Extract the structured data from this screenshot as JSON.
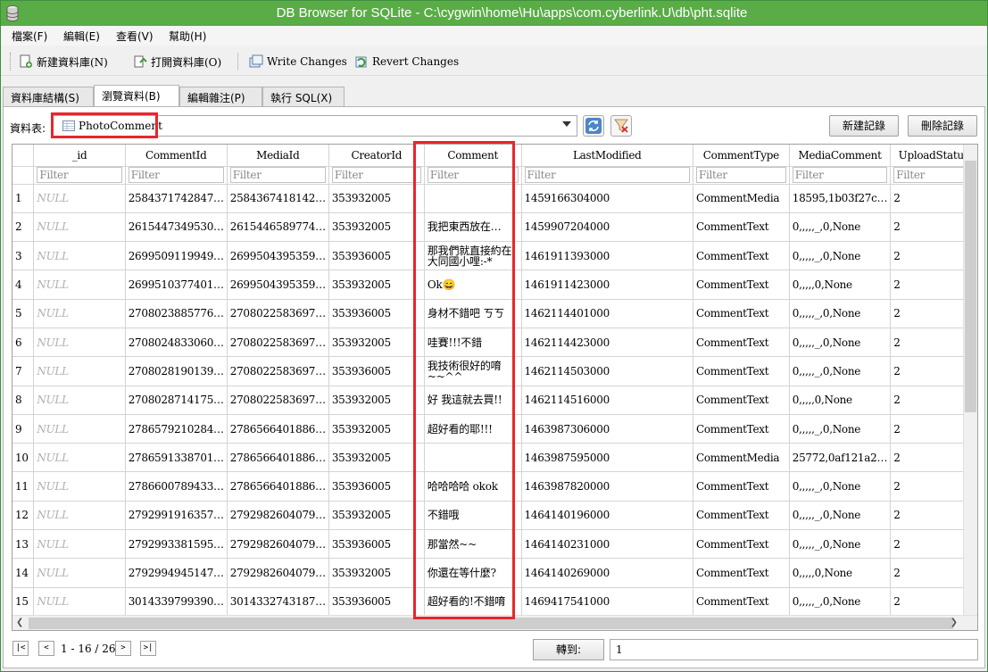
{
  "window": {
    "title": "DB Browser for SQLite - C:\\cygwin\\home\\Hu\\apps\\com.cyberlink.U\\db\\pht.sqlite"
  },
  "menu": [
    "檔案(F)",
    "編輯(E)",
    "查看(V)",
    "幫助(H)"
  ],
  "toolbar": {
    "new_db": "新建資料庫(N)",
    "open_db": "打開資料庫(O)",
    "write_changes": "Write Changes",
    "revert_changes": "Revert Changes"
  },
  "tabs": [
    "資料庫結構(S)",
    "瀏覽資料(B)",
    "編輯雜注(P)",
    "執行 SQL(X)"
  ],
  "browse": {
    "table_label": "資料表:",
    "table_value": "PhotoComment",
    "new_record": "新建記錄",
    "delete_record": "刪除記錄"
  },
  "grid": {
    "columns": [
      "_id",
      "CommentId",
      "MediaId",
      "CreatorId",
      "Comment",
      "LastModified",
      "CommentType",
      "MediaComment",
      "UploadStatus"
    ],
    "filter_placeholder": "Filter",
    "rows": [
      [
        "1",
        "NULL",
        "2584371742847…",
        "2584367418142…",
        "353932005",
        "",
        "1459166304000",
        "CommentMedia",
        "18595,1b03f27c…",
        "2"
      ],
      [
        "2",
        "NULL",
        "2615447349530…",
        "2615446589774…",
        "353932005",
        "我把東西放在…",
        "1459907204000",
        "CommentText",
        "0,,,,,_,0,None",
        "2"
      ],
      [
        "3",
        "NULL",
        "2699509119949…",
        "2699504395359…",
        "353936005",
        "那我們就直接約在大同國小哩:-*",
        "1461911393000",
        "CommentText",
        "0,,,,,_,0,None",
        "2"
      ],
      [
        "4",
        "NULL",
        "2699510377401…",
        "2699504395359…",
        "353932005",
        "Ok😄",
        "1461911423000",
        "CommentText",
        "0,,,,,0,None",
        "2"
      ],
      [
        "5",
        "NULL",
        "2708023885776…",
        "2708022583697…",
        "353936005",
        "身材不錯吧 ㄎㄎ",
        "1462114401000",
        "CommentText",
        "0,,,,,_,0,None",
        "2"
      ],
      [
        "6",
        "NULL",
        "2708024833060…",
        "2708022583697…",
        "353932005",
        "哇賽!!!不錯",
        "1462114423000",
        "CommentText",
        "0,,,,,_,0,None",
        "2"
      ],
      [
        "7",
        "NULL",
        "2708028190139…",
        "2708022583697…",
        "353936005",
        "我技術很好的唷~~^^",
        "1462114503000",
        "CommentText",
        "0,,,,,_,0,None",
        "2"
      ],
      [
        "8",
        "NULL",
        "2708028714175…",
        "2708022583697…",
        "353932005",
        "好 我這就去買!!",
        "1462114516000",
        "CommentText",
        "0,,,,,0,None",
        "2"
      ],
      [
        "9",
        "NULL",
        "2786579210284…",
        "2786566401886…",
        "353932005",
        "超好看的耶!!!",
        "1463987306000",
        "CommentText",
        "0,,,,,_,0,None",
        "2"
      ],
      [
        "10",
        "NULL",
        "2786591338701…",
        "2786566401886…",
        "353932005",
        "",
        "1463987595000",
        "CommentMedia",
        "25772,0af121a2…",
        "2"
      ],
      [
        "11",
        "NULL",
        "2786600789433…",
        "2786566401886…",
        "353936005",
        "哈哈哈哈 okok",
        "1463987820000",
        "CommentText",
        "0,,,,,_,0,None",
        "2"
      ],
      [
        "12",
        "NULL",
        "2792991916357…",
        "2792982604079…",
        "353932005",
        "不錯哦",
        "1464140196000",
        "CommentText",
        "0,,,,,_,0,None",
        "2"
      ],
      [
        "13",
        "NULL",
        "2792993381595…",
        "2792982604079…",
        "353936005",
        "那當然~~",
        "1464140231000",
        "CommentText",
        "0,,,,,_,0,None",
        "2"
      ],
      [
        "14",
        "NULL",
        "2792994945147…",
        "2792982604079…",
        "353932005",
        "你還在等什麼?",
        "1464140269000",
        "CommentText",
        "0,,,,,0,None",
        "2"
      ],
      [
        "15",
        "NULL",
        "3014339799390…",
        "3014332743187…",
        "353936005",
        "超好看的!不錯唷",
        "1469417541000",
        "CommentText",
        "0,,,,,_,0,None",
        "2"
      ]
    ]
  },
  "pager": {
    "first": "|<",
    "prev": "<",
    "range": "1 - 16 / 26",
    "next": ">",
    "last": ">|",
    "goto_label": "轉到:",
    "goto_value": "1"
  }
}
